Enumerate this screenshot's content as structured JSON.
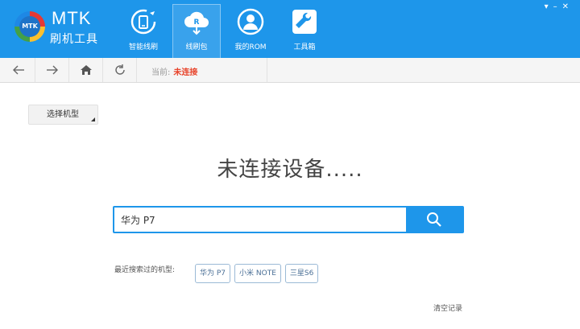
{
  "brand": {
    "line1": "MTK",
    "line2": "刷机工具",
    "logo_text": "MTK"
  },
  "nav": [
    {
      "label": "智能线刷",
      "icon": "smart-flash-icon"
    },
    {
      "label": "线刷包",
      "icon": "cloud-download-icon"
    },
    {
      "label": "我的ROM",
      "icon": "user-rom-icon"
    },
    {
      "label": "工具箱",
      "icon": "wrench-icon"
    }
  ],
  "window_controls": [
    "▾",
    "–",
    "✕"
  ],
  "toolbar": {
    "current_label": "当前:",
    "status": "未连接"
  },
  "model_select": {
    "label": "选择机型"
  },
  "heading": "未连接设备.....",
  "search": {
    "value": "华为 P7"
  },
  "recent": {
    "label": "最近搜索过的机型:",
    "items": [
      "华为 P7",
      "小米 NOTE",
      "三星S6"
    ]
  },
  "clear": "清空记录",
  "colors": {
    "accent": "#1e96ea",
    "status": "#e8452c"
  }
}
